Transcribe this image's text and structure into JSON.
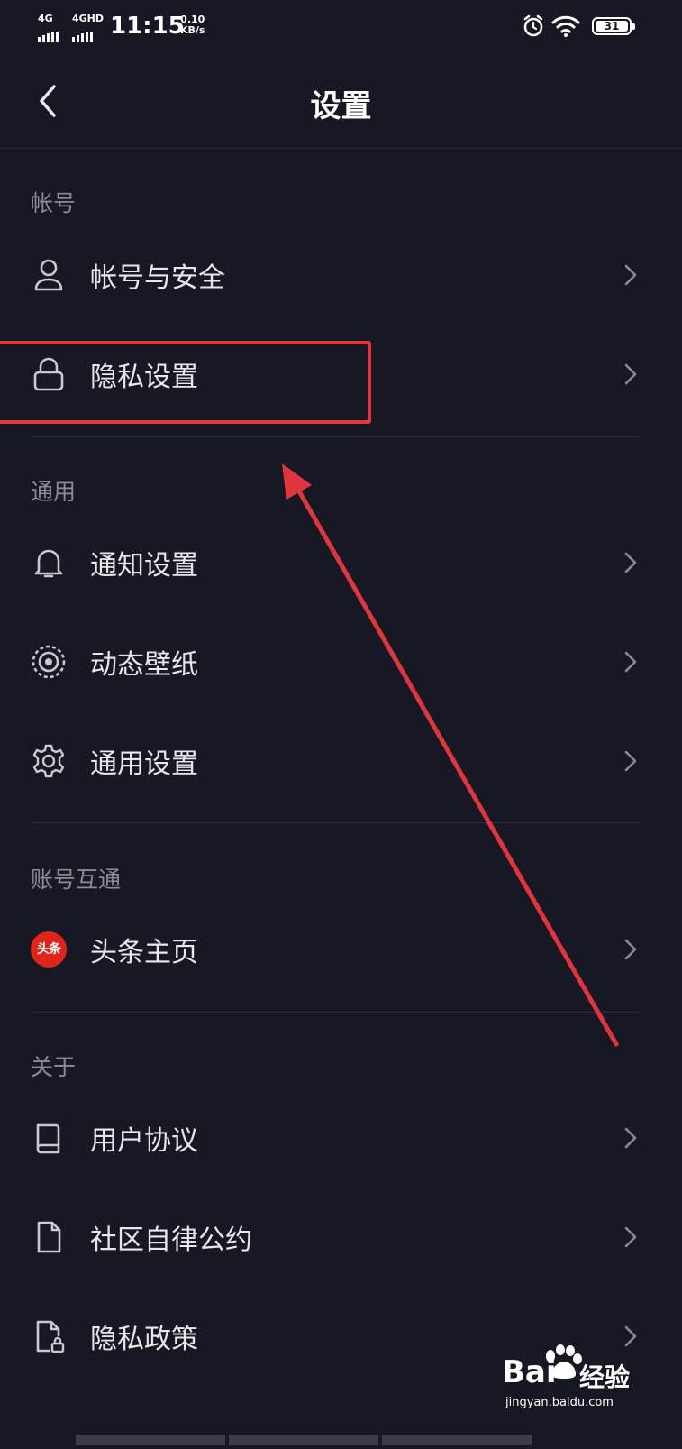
{
  "status_bar": {
    "sig1": "4G",
    "sig2": "4GHD",
    "time": "11:15",
    "speed_value": "0.10",
    "speed_unit": "KB/s",
    "battery": "31"
  },
  "nav": {
    "title": "设置"
  },
  "sections": {
    "account": {
      "header": "帐号",
      "items": [
        {
          "label": "帐号与安全",
          "icon": "person-icon"
        },
        {
          "label": "隐私设置",
          "icon": "lock-icon"
        }
      ]
    },
    "general": {
      "header": "通用",
      "items": [
        {
          "label": "通知设置",
          "icon": "bell-icon"
        },
        {
          "label": "动态壁纸",
          "icon": "live-wallpaper-icon"
        },
        {
          "label": "通用设置",
          "icon": "gear-icon"
        }
      ]
    },
    "linked": {
      "header": "账号互通",
      "items": [
        {
          "label": "头条主页",
          "icon": "toutiao-logo-icon",
          "logo_text": "头条"
        }
      ]
    },
    "about": {
      "header": "关于",
      "items": [
        {
          "label": "用户协议",
          "icon": "book-icon"
        },
        {
          "label": "社区自律公约",
          "icon": "document-icon"
        },
        {
          "label": "隐私政策",
          "icon": "privacy-document-icon"
        }
      ]
    }
  },
  "watermark": {
    "brand": "Bai",
    "brand_cn": "经验",
    "url": "jingyan.baidu.com"
  },
  "colors": {
    "background": "#161823",
    "highlight": "#e0353c",
    "text": "#e8e8ea",
    "muted": "#8a8b93"
  }
}
